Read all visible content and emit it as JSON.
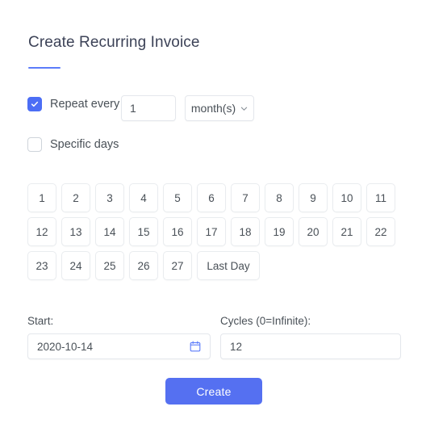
{
  "header": {
    "title": "Create Recurring Invoice"
  },
  "options": {
    "repeat": {
      "label": "Repeat every",
      "checked": true,
      "interval_value": "1",
      "unit_label": "month(s)"
    },
    "specific_days": {
      "label": "Specific days",
      "checked": false
    }
  },
  "days": [
    "1",
    "2",
    "3",
    "4",
    "5",
    "6",
    "7",
    "8",
    "9",
    "10",
    "11",
    "12",
    "13",
    "14",
    "15",
    "16",
    "17",
    "18",
    "19",
    "20",
    "21",
    "22",
    "23",
    "24",
    "25",
    "26",
    "27",
    "Last Day"
  ],
  "fields": {
    "start": {
      "label": "Start:",
      "value": "2020-10-14",
      "icon": "calendar-icon"
    },
    "cycles": {
      "label": "Cycles (0=Infinite):",
      "value": "12"
    }
  },
  "actions": {
    "submit_label": "Create"
  },
  "colors": {
    "accent": "#5570f1",
    "checkbox_checked": "#4c6ef5",
    "title_underline": "#5c7cfa",
    "border": "#e4e7ec",
    "text": "#495057",
    "background": "#ffffff"
  }
}
